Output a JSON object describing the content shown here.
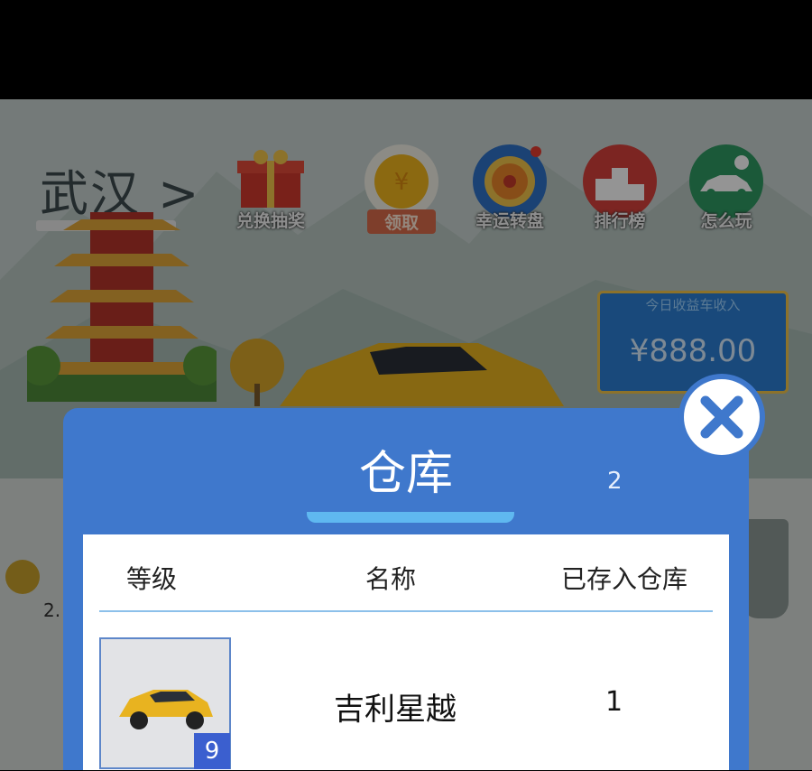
{
  "header": {
    "city": "武汉 >"
  },
  "toolbar": {
    "items": [
      {
        "label": "兑换抽奖",
        "icon": "gift-icon"
      },
      {
        "label": "领取",
        "icon": "coin-icon"
      },
      {
        "label": "幸运转盘",
        "icon": "wheel-icon"
      },
      {
        "label": "排行榜",
        "icon": "podium-icon"
      },
      {
        "label": "怎么玩",
        "icon": "car-help-icon"
      }
    ]
  },
  "income": {
    "title": "今日收益车收入",
    "value": "¥888.00"
  },
  "background": {
    "left_value": "2."
  },
  "modal": {
    "title": "仓库",
    "count": "2",
    "columns": [
      "等级",
      "名称",
      "已存入仓库"
    ],
    "rows": [
      {
        "level": "9",
        "name": "吉利星越",
        "stored": "1"
      }
    ]
  },
  "colors": {
    "modal_blue": "#3f78cc",
    "accent_gold": "#f2c44b",
    "level_badge": "#3b5fcf"
  }
}
